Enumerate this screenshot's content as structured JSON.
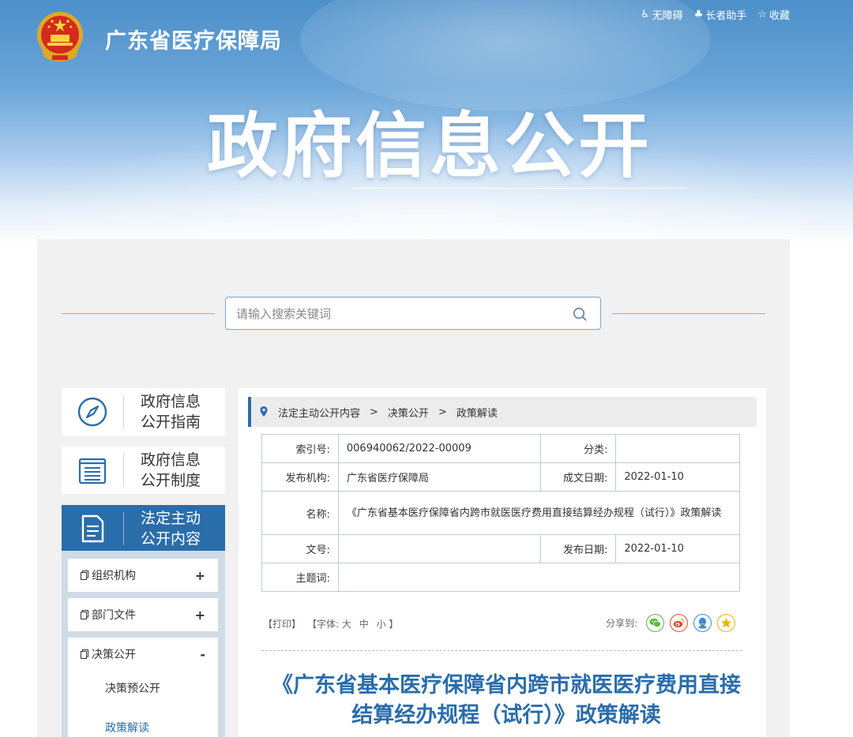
{
  "header": {
    "site_title": "广东省医疗保障局",
    "banner_title": "政府信息公开",
    "top_links": [
      {
        "label": "无障碍",
        "icon": "accessibility-icon"
      },
      {
        "label": "长者助手",
        "icon": "elder-assist-icon"
      },
      {
        "label": "收藏",
        "icon": "star-icon"
      }
    ]
  },
  "search": {
    "placeholder": "请输入搜索关键词"
  },
  "sidebar": {
    "cards": [
      {
        "line1": "政府信息",
        "line2": "公开指南",
        "icon": "compass-icon"
      },
      {
        "line1": "政府信息",
        "line2": "公开制度",
        "icon": "list-document-icon"
      },
      {
        "line1": "法定主动",
        "line2": "公开内容",
        "icon": "document-icon"
      }
    ],
    "sub_items": [
      {
        "label": "组织机构",
        "sign": "+"
      },
      {
        "label": "部门文件",
        "sign": "+"
      },
      {
        "label": "决策公开",
        "sign": "-"
      }
    ],
    "children": [
      {
        "label": "决策预公开"
      },
      {
        "label": "政策解读"
      }
    ]
  },
  "breadcrumb": [
    "法定主动公开内容",
    "决策公开",
    "政策解读"
  ],
  "meta": {
    "index_label": "索引号:",
    "index_value": "006940062/2022-00009",
    "category_label": "分类:",
    "category_value": "",
    "org_label": "发布机构:",
    "org_value": "广东省医疗保障局",
    "created_label": "成文日期:",
    "created_value": "2022-01-10",
    "name_label": "名称:",
    "name_value": "《广东省基本医疗保障省内跨市就医医疗费用直接结算经办规程（试行）》政策解读",
    "docno_label": "文号:",
    "docno_value": "",
    "published_label": "发布日期:",
    "published_value": "2022-01-10",
    "subject_label": "主题词:",
    "subject_value": ""
  },
  "tools": {
    "print": "【打印】",
    "font_prefix": "【字体:",
    "font_large": "大",
    "font_medium": "中",
    "font_small": "小",
    "font_suffix": "】"
  },
  "share": {
    "label": "分享到:",
    "icons": [
      "wechat-icon",
      "weibo-icon",
      "qq-icon",
      "qzone-icon"
    ],
    "colors": [
      "#5ab83a",
      "#e6492d",
      "#2f8fd8",
      "#f3b400"
    ]
  },
  "article": {
    "title_line1": "《广东省基本医疗保障省内跨市就医医疗费用直接",
    "title_line2": "结算经办规程（试行）》政策解读"
  },
  "colors": {
    "accent": "#2a6dab",
    "panel_bg": "#f1f1f1"
  }
}
